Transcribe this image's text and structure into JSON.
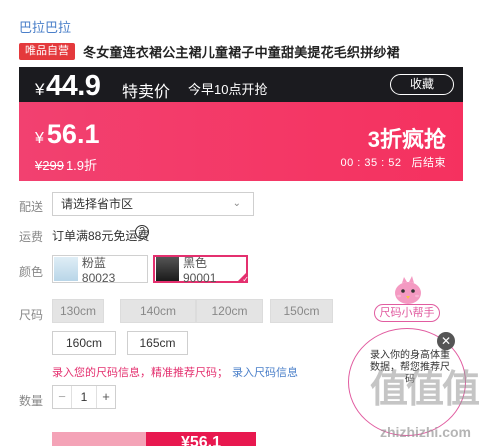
{
  "brand": "巴拉巴拉",
  "badge": "唯品自营",
  "product_title": "冬女童连衣裙公主裙儿童裙子中童甜美提花毛织拼纱裙",
  "flash": {
    "currency": "¥",
    "price": "44.9",
    "label": "特卖价",
    "time": "今早10点开抢",
    "collect": "收藏"
  },
  "sale": {
    "currency": "¥",
    "price": "56.1",
    "original_currency": "¥",
    "original_price": "299",
    "discount_note": "1.9折",
    "title": "3折疯抢",
    "countdown": "00 : 35 : 52",
    "countdown_suffix": "后结束"
  },
  "shipping": {
    "label": "配送",
    "placeholder": "请选择省市区"
  },
  "freight": {
    "label": "运费",
    "text": "订单满88元免运费",
    "help": "?"
  },
  "color": {
    "label": "颜色",
    "options": [
      {
        "name": "粉蓝80023",
        "selected": false,
        "thumb_color": "#cfe3ee"
      },
      {
        "name": "黑色90001",
        "selected": true,
        "thumb_color": "#2a2a2a"
      }
    ]
  },
  "size": {
    "label": "尺码",
    "options": [
      "130cm",
      "140cm",
      "120cm",
      "150cm",
      "160cm",
      "165cm"
    ],
    "hint_pink": "录入您的尺码信息，精准推荐尺码；",
    "hint_link": "录入尺码信息"
  },
  "quantity": {
    "label": "数量",
    "minus": "−",
    "value": "1",
    "plus": "+"
  },
  "buttons": {
    "buy_price": "¥56.1"
  },
  "helper": {
    "pill": "尺码小帮手",
    "text": "录入你的身高体重数据，帮您推荐尺码",
    "close": "✕"
  },
  "watermark": {
    "text": "值值值",
    "url": "zhizhizhi.com"
  },
  "colors": {
    "brand_link": "#4a7fc9",
    "flash_bg": "#1b1b1f",
    "sale_bg": "#f5315f",
    "accent": "#e4306f"
  }
}
